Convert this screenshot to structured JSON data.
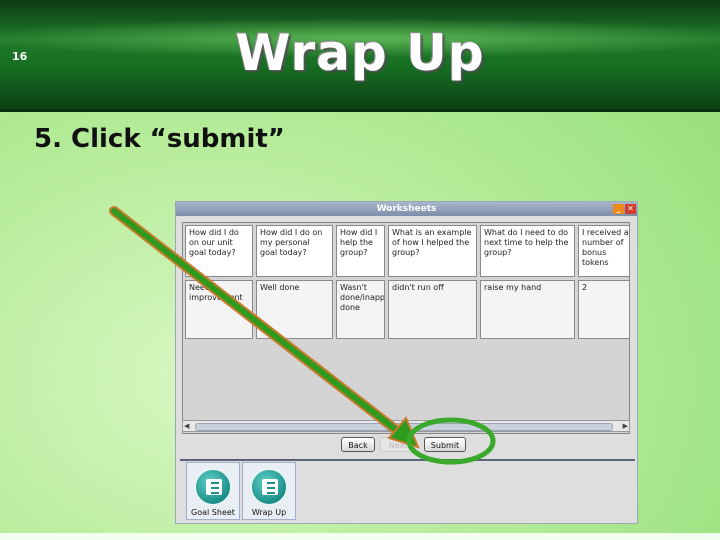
{
  "slide": {
    "number": "16",
    "title": "Wrap Up",
    "subtitle": "5. Click “submit”"
  },
  "window": {
    "title": "Worksheets",
    "controls": {
      "minimize_icon": "minimize-icon",
      "close_icon": "close-icon",
      "close_glyph": "✕"
    },
    "questions": [
      "How did I do on our unit goal today?",
      "How did I do on my personal goal today?",
      "How did I help the group?",
      "What is an example of how I helped the group?",
      "What do I need to do next time to help the group?",
      "I received a number of bonus tokens"
    ],
    "answers": [
      "Needs improvement",
      "Well done",
      "Wasn't done/inappropriately done",
      "didn't run off",
      "raise my hand",
      "2"
    ],
    "buttons": {
      "back": "Back",
      "next": "Next",
      "submit": "Submit"
    }
  },
  "taskbar": {
    "items": [
      {
        "label": "Goal Sheet",
        "icon": "worksheet-icon"
      },
      {
        "label": "Wrap Up",
        "icon": "worksheet-icon"
      }
    ]
  },
  "annotations": {
    "arrow_color": "#2e9b1f",
    "arrow_outline": "#c77a2a",
    "highlight_color": "#3aa82a"
  }
}
